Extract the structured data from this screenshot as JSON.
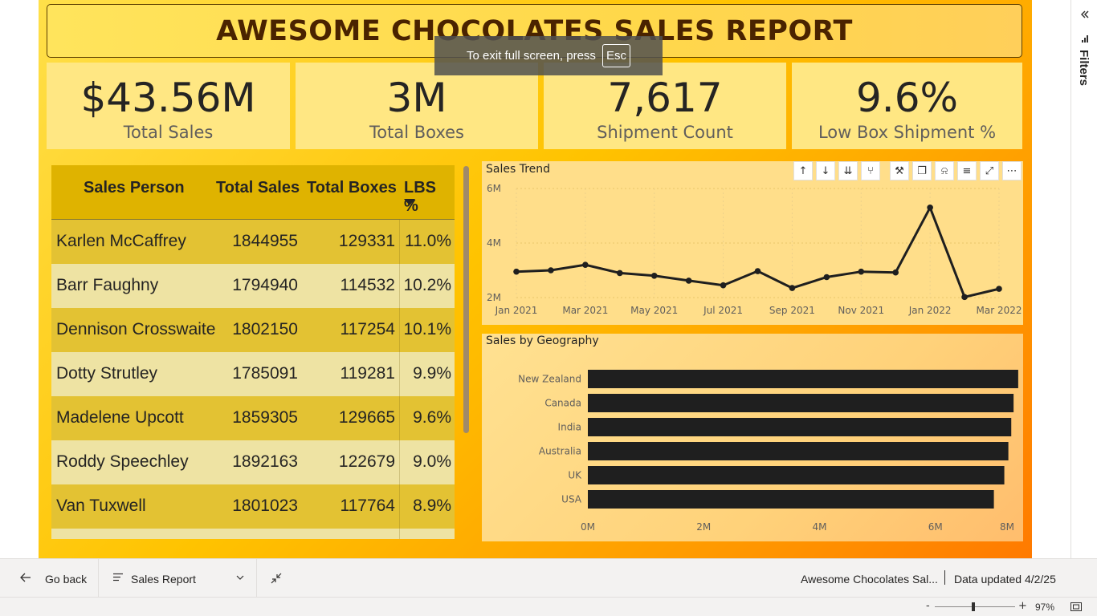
{
  "report": {
    "title": "AWESOME CHOCOLATES SALES REPORT",
    "kpis": [
      {
        "value": "$43.56M",
        "label": "Total Sales"
      },
      {
        "value": "3M",
        "label": "Total Boxes"
      },
      {
        "value": "7,617",
        "label": "Shipment Count"
      },
      {
        "value": "9.6%",
        "label": "Low Box Shipment %"
      }
    ]
  },
  "table": {
    "headers": [
      "Sales Person",
      "Total Sales",
      "Total Boxes",
      "LBS %"
    ],
    "sort_icon": "sort-descending-icon",
    "rows": [
      [
        "Karlen McCaffrey",
        "1844955",
        "129331",
        "11.0%"
      ],
      [
        "Barr Faughny",
        "1794940",
        "114532",
        "10.2%"
      ],
      [
        "Dennison Crosswaite",
        "1802150",
        "117254",
        "10.1%"
      ],
      [
        "Dotty Strutley",
        "1785091",
        "119281",
        "9.9%"
      ],
      [
        "Madelene Upcott",
        "1859305",
        "129665",
        "9.6%"
      ],
      [
        "Roddy Speechley",
        "1892163",
        "122679",
        "9.0%"
      ],
      [
        "Van Tuxwell",
        "1801023",
        "117764",
        "8.9%"
      ]
    ]
  },
  "overlay": {
    "text": "To exit full screen, press",
    "key": "Esc"
  },
  "filters": {
    "label": "Filters"
  },
  "visual_toolbar": [
    "arrow-up-icon",
    "arrow-down-icon",
    "double-arrow-down-icon",
    "hierarchy-icon",
    "pin-icon",
    "copy-icon",
    "bell-icon",
    "filter-icon",
    "focus-mode-icon",
    "more-options-icon"
  ],
  "bottom": {
    "go_back": "Go back",
    "page_name": "Sales Report",
    "report_name": "Awesome Chocolates Sal...",
    "data_updated": "Data updated 4/2/25",
    "zoom": "97%"
  },
  "colors": {
    "bar": "#1f1f1f",
    "line": "#1f1f1f",
    "title": "#4a2300"
  },
  "chart_data": [
    {
      "type": "line",
      "title": "Sales Trend",
      "x": [
        "Jan 2021",
        "Feb 2021",
        "Mar 2021",
        "Apr 2021",
        "May 2021",
        "Jun 2021",
        "Jul 2021",
        "Aug 2021",
        "Sep 2021",
        "Oct 2021",
        "Nov 2021",
        "Dec 2021",
        "Jan 2022",
        "Feb 2022",
        "Mar 2022"
      ],
      "x_tick_labels": [
        "Jan 2021",
        "Mar 2021",
        "May 2021",
        "Jul 2021",
        "Sep 2021",
        "Nov 2021",
        "Jan 2022",
        "Mar 2022"
      ],
      "values": [
        2.95,
        3.0,
        3.2,
        2.9,
        2.8,
        2.62,
        2.45,
        2.97,
        2.35,
        2.75,
        2.95,
        2.92,
        5.3,
        2.02,
        2.32
      ],
      "y_unit": "M",
      "y_ticks": [
        "2M",
        "4M",
        "6M"
      ],
      "ylim": [
        2,
        6
      ]
    },
    {
      "type": "bar",
      "orientation": "horizontal",
      "title": "Sales by Geography",
      "categories": [
        "New Zealand",
        "Canada",
        "India",
        "Australia",
        "UK",
        "USA"
      ],
      "values": [
        7.43,
        7.35,
        7.31,
        7.26,
        7.19,
        7.01
      ],
      "x_ticks": [
        "0M",
        "2M",
        "4M",
        "6M",
        "8M"
      ],
      "xlim": [
        0,
        8
      ]
    }
  ]
}
